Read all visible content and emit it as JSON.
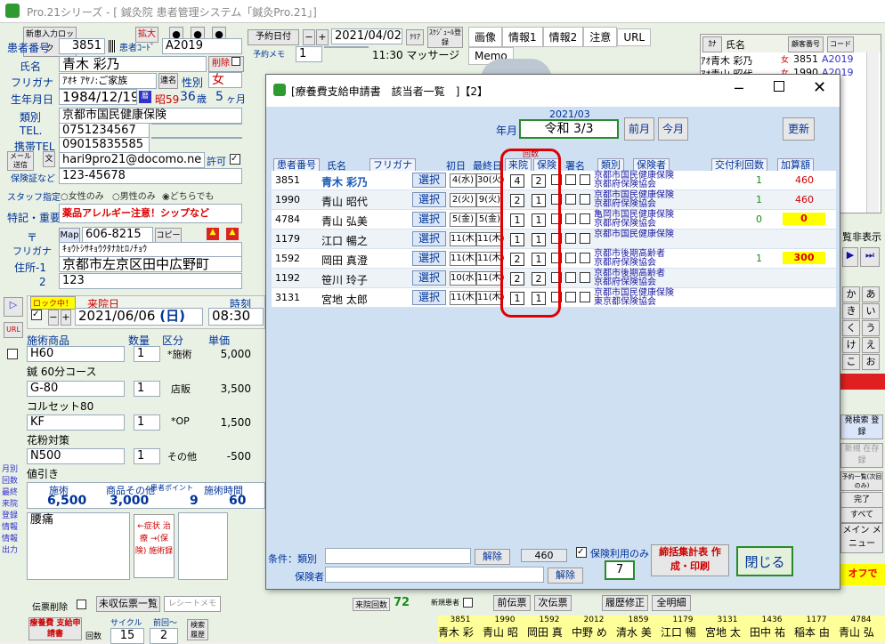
{
  "window": {
    "title": "Pro.21シリーズ - [ 鍼灸院 患者管理システム「鍼灸Pro.21」]"
  },
  "patient": {
    "new_card_label": "新患入力ロック",
    "zoom_label": "拡大",
    "number_label": "患者番号",
    "number": "3851",
    "code_label": "患者ｺｰﾄﾞ",
    "code": "A2019",
    "name_label": "氏名",
    "name": "青木 彩乃",
    "delete_label": "削除",
    "furigana_label": "フリガナ",
    "furigana": "ｱｵｷ ｱﾔﾉ:ご家族",
    "gender_label": "性別",
    "gender": "女",
    "dob_label": "生年月日",
    "dob": "1984/12/19",
    "era": "昭59",
    "age": "36",
    "age_unit": "歳",
    "months": "5",
    "months_unit": "ヶ月",
    "type_label": "類別",
    "type": "京都市国民健康保険",
    "tel_label": "TEL.",
    "tel": "0751234567",
    "mobile_label": "携帯TEL",
    "mobile": "09015835585",
    "mail_label": "メール送信",
    "email": "hari9pro21@docomo.ne",
    "permit_label": "許可",
    "insurance_label": "保険証など",
    "insurance_no": "123-45678",
    "staff_label": "スタッフ指定",
    "staff_opts": [
      "女性のみ",
      "男性のみ",
      "どちらでも"
    ],
    "note_label": "特記・重要",
    "note": "薬品アレルギー注意！シップなど",
    "zip_label": "〒",
    "map_label": "Map",
    "zip": "606-8215",
    "copy_label": "コピー",
    "addr_kana_label": "フリガナ",
    "addr_kana": "ｷｮｳﾄｼｻｷｮｳｸﾀﾅｶﾋﾛﾉﾁｮｳ",
    "addr1_label": "住所-1",
    "addr1": "京都市左京区田中広野町",
    "addr2_label": "2",
    "addr2": "123"
  },
  "booking": {
    "date_label": "予約日付",
    "date": "2021/04/02",
    "clear_label": "ｸﾘｱ",
    "schedule_label": "ｽｹｼﾞｭｰﾙ登録",
    "memo_label": "予約メモ",
    "memo_value": "1",
    "time_text": "11:30 マッサージ"
  },
  "tabs": [
    "画像",
    "情報1",
    "情報2",
    "注意",
    "URL",
    "Memo"
  ],
  "plist": {
    "header_kana": "ｶﾅ",
    "header_name": "氏名",
    "header_no": "顧客番号",
    "header_code": "コード",
    "rows": [
      {
        "kana": "ｱｵ",
        "name": "青木 彩乃",
        "sex": "女",
        "no": "3851",
        "code": "A2019"
      },
      {
        "kana": "ｱｵ",
        "name": "青山 昭代",
        "sex": "女",
        "no": "1990",
        "code": "A2019"
      }
    ]
  },
  "visit": {
    "lock_label": "ロック中！",
    "date_label": "来院日",
    "date": "2021/06/06",
    "weekday": "(日)",
    "time_label": "時刻",
    "time": "08:30"
  },
  "items": {
    "headers": [
      "施術商品",
      "数量",
      "区分",
      "単価"
    ],
    "rows": [
      {
        "code": "H60",
        "qty": "1",
        "kind": "*施術",
        "price": "5,000",
        "name": "鍼 60分コース"
      },
      {
        "code": "G-80",
        "qty": "1",
        "kind": "店販",
        "price": "3,500",
        "name": "コルセット80"
      },
      {
        "code": "KF",
        "qty": "1",
        "kind": "*OP",
        "price": "1,500",
        "name": "花粉対策"
      },
      {
        "code": "N500",
        "qty": "1",
        "kind": "その他",
        "price": "-500",
        "name": "値引き"
      }
    ],
    "sum_labels": [
      "施術",
      "商品その他",
      "患者ポイント",
      "施術時間"
    ],
    "sum_values": [
      "6,500",
      "3,000",
      "9",
      "60"
    ]
  },
  "symptom": {
    "text": "腰痛",
    "arrow_text": "←症状 治療 →(保険) 施術録"
  },
  "left_side": [
    "月別",
    "回数",
    "最終",
    "来院",
    "登録",
    "情報",
    "情報",
    "出力"
  ],
  "footer": {
    "receipt_delete": "伝票削除",
    "unpaid": "未収伝票一覧",
    "receipt_memo": "レシートメモ",
    "visits_label": "来院回数",
    "visits": "72",
    "new_patient_label": "新規患者",
    "prev": "前伝票",
    "next": "次伝票",
    "history": "履歴修正",
    "all_detail": "全明細",
    "ryoyo_label": "療養費 支給申請書",
    "cycle_label": "サイクル",
    "cycle": "15",
    "prev_label": "前回〜",
    "prev_val": "2",
    "history_label": "検索 履歴",
    "count_label": "回数",
    "strip": [
      {
        "no": "3851",
        "name": "青木 彩"
      },
      {
        "no": "1990",
        "name": "青山 昭"
      },
      {
        "no": "1592",
        "name": "岡田 真"
      },
      {
        "no": "2012",
        "name": "中野 め"
      },
      {
        "no": "1859",
        "name": "清水 美"
      },
      {
        "no": "1179",
        "name": "江口 暢"
      },
      {
        "no": "3131",
        "name": "宮地 太"
      },
      {
        "no": "1436",
        "name": "田中 祐"
      },
      {
        "no": "1177",
        "name": "稲本 由"
      },
      {
        "no": "4784",
        "name": "青山 弘"
      }
    ]
  },
  "right_panel": {
    "hide_label": "覧非表示",
    "kana_keys": [
      "か",
      "あ",
      "き",
      "い",
      "く",
      "う",
      "け",
      "え",
      "こ",
      "お"
    ],
    "search_label": "発検索 登録",
    "new_label": "新規 在存録",
    "buttons": [
      "予約一覧(次回のみ)",
      "完了",
      "すべて"
    ],
    "menu_label": "メイン メニュー",
    "off_label": "オフで"
  },
  "dialog": {
    "title": "[療養費支給申請書　該当者一覧　]【2】",
    "period": "2021/03",
    "ym_label": "年月",
    "ym_value": "令和 3/3",
    "prev_month": "前月",
    "this_month": "今月",
    "refresh": "更新",
    "col_headers": {
      "no": "患者番号",
      "name": "氏名",
      "kana": "フリガナ",
      "first": "初日",
      "last": "最終日",
      "visit": "来院",
      "insure": "保険",
      "count_title": "回数",
      "sign": "署名",
      "type": "類別",
      "insurer": "保険者",
      "issue": "交付利回数",
      "amount": "加算額"
    },
    "select_label": "選択",
    "rows": [
      {
        "no": "3851",
        "name": "青木 彩乃",
        "first": "4(水)",
        "last": "30(火)",
        "visit": "4",
        "insure": "2",
        "ins1": "京都市国民健康保険",
        "ins2": "京都府保険協会",
        "issue": "1",
        "amount": "460"
      },
      {
        "no": "1990",
        "name": "青山 昭代",
        "first": "2(火)",
        "last": "9(火)",
        "visit": "2",
        "insure": "1",
        "ins1": "京都市国民健康保険",
        "ins2": "京都府保険協会",
        "issue": "1",
        "amount": "460"
      },
      {
        "no": "4784",
        "name": "青山 弘美",
        "first": "5(金)",
        "last": "5(金)",
        "visit": "1",
        "insure": "1",
        "ins1": "亀岡市国民健康保険",
        "ins2": "京都府保険協会",
        "issue": "0",
        "amount": "0"
      },
      {
        "no": "1179",
        "name": "江口 暢之",
        "first": "11(木)",
        "last": "11(木)",
        "visit": "1",
        "insure": "1",
        "ins1": "京都市国民健康保険",
        "ins2": "",
        "issue": "",
        "amount": ""
      },
      {
        "no": "1592",
        "name": "岡田 真澄",
        "first": "11(木)",
        "last": "11(木)",
        "visit": "2",
        "insure": "1",
        "ins1": "京都市後期高齢者",
        "ins2": "京都府保険協会",
        "issue": "1",
        "amount": "300"
      },
      {
        "no": "1192",
        "name": "笹川 玲子",
        "first": "10(水)",
        "last": "11(木)",
        "visit": "2",
        "insure": "2",
        "ins1": "京都市後期高齢者",
        "ins2": "京都府保険協会",
        "issue": "",
        "amount": ""
      },
      {
        "no": "3131",
        "name": "宮地 太郎",
        "first": "11(木)",
        "last": "11(木)",
        "visit": "1",
        "insure": "1",
        "ins1": "京都市国民健康保険",
        "ins2": "東京都保険協会",
        "issue": "",
        "amount": ""
      }
    ],
    "cond_label": "条件：類別",
    "insurer_label": "保険者",
    "clear": "解除",
    "total": "460",
    "use_only_label": "保険利用のみ",
    "use_count": "7",
    "summary_btn": "締括集計表 作成・印刷",
    "close_btn": "閉じる"
  }
}
